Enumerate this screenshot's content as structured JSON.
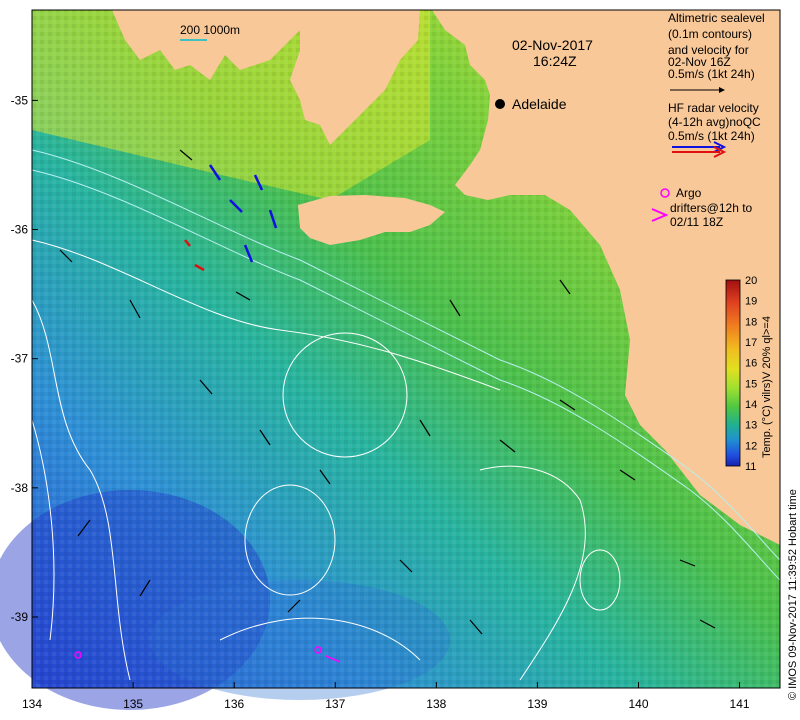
{
  "map": {
    "region": "South Australia coastal waters",
    "colors": {
      "land": "#f8c898",
      "contour": "#ffffff",
      "shelf_contour": "#b6f0f0",
      "argo": "#ff00ff",
      "hf_radar_blue": "#1010e0",
      "hf_radar_red": "#e01010",
      "scale_bar": "#40c0c0"
    }
  },
  "date_label": {
    "date": "02-Nov-2017",
    "time": "16:24Z"
  },
  "city": {
    "name": "Adelaide"
  },
  "scale": {
    "label": "200  1000m"
  },
  "legend": {
    "altimetric": [
      "Altimetric sealevel",
      "(0.1m contours)",
      "and velocity for",
      "02-Nov 16Z",
      "0.5m/s (1kt 24h)"
    ],
    "hf_radar": [
      "HF radar velocity",
      "(4-12h avg)noQC",
      "0.5m/s (1kt 24h)"
    ],
    "argo": [
      "Argo",
      "drifters@12h to",
      "02/11 18Z"
    ]
  },
  "colorbar": {
    "label": "Temp. (°C) vilrs)V 20% ql>=4",
    "ticks": [
      "20",
      "19",
      "18",
      "17",
      "16",
      "15",
      "14",
      "13",
      "12",
      "11"
    ],
    "colors": [
      "#a01010",
      "#e04020",
      "#f08020",
      "#f0c020",
      "#e0e020",
      "#a0e030",
      "#50c840",
      "#20b090",
      "#2090d0",
      "#2050e0",
      "#1820b0"
    ]
  },
  "credit": "© IMOS 09-Nov-2017 11:39:52 Hobart time",
  "axes": {
    "x_ticks": [
      "134",
      "135",
      "136",
      "137",
      "138",
      "139",
      "140",
      "141"
    ],
    "y_ticks": [
      "-35",
      "-36",
      "-37",
      "-38",
      "-39"
    ],
    "lon_range": [
      134,
      141.4
    ],
    "lat_range": [
      -39.55,
      -34.3
    ]
  }
}
